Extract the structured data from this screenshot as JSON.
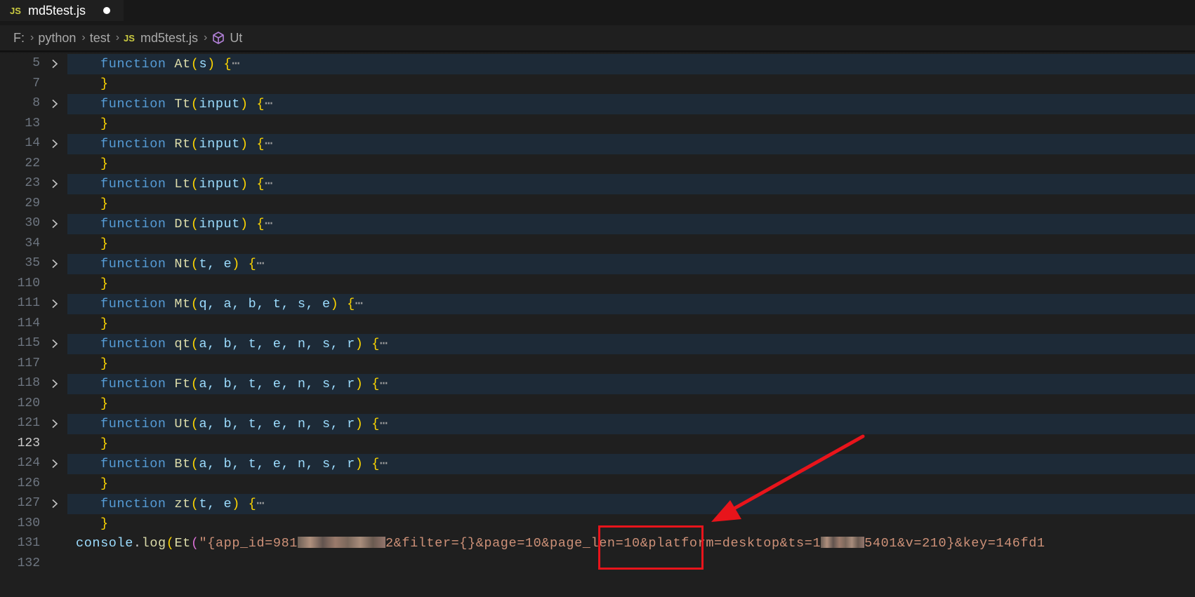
{
  "tab": {
    "icon": "JS",
    "title": "md5test.js"
  },
  "breadcrumb": {
    "items": [
      "F:",
      "python",
      "test",
      "md5test.js",
      "Ut"
    ],
    "js_icon": "JS"
  },
  "editor": {
    "lines": [
      {
        "n": "5",
        "sig": "function",
        "name": "At",
        "params": "s",
        "folded": true
      },
      {
        "n": "7",
        "close": "}"
      },
      {
        "n": "8",
        "sig": "function",
        "name": "Tt",
        "params": "input",
        "folded": true
      },
      {
        "n": "13",
        "close": "}"
      },
      {
        "n": "14",
        "sig": "function",
        "name": "Rt",
        "params": "input",
        "folded": true
      },
      {
        "n": "22",
        "close": "}"
      },
      {
        "n": "23",
        "sig": "function",
        "name": "Lt",
        "params": "input",
        "folded": true
      },
      {
        "n": "29",
        "close": "}"
      },
      {
        "n": "30",
        "sig": "function",
        "name": "Dt",
        "params": "input",
        "folded": true
      },
      {
        "n": "34",
        "close": "}"
      },
      {
        "n": "35",
        "sig": "function",
        "name": "Nt",
        "params": "t, e",
        "folded": true
      },
      {
        "n": "110",
        "close": "}"
      },
      {
        "n": "111",
        "sig": "function",
        "name": "Mt",
        "params": "q, a, b, t, s, e",
        "folded": true
      },
      {
        "n": "114",
        "close": "}"
      },
      {
        "n": "115",
        "sig": "function",
        "name": "qt",
        "params": "a, b, t, e, n, s, r",
        "folded": true
      },
      {
        "n": "117",
        "close": "}"
      },
      {
        "n": "118",
        "sig": "function",
        "name": "Ft",
        "params": "a, b, t, e, n, s, r",
        "folded": true
      },
      {
        "n": "120",
        "close": "}"
      },
      {
        "n": "121",
        "sig": "function",
        "name": "Ut",
        "params": "a, b, t, e, n, s, r",
        "folded": true
      },
      {
        "n": "123",
        "close": "}",
        "active": true
      },
      {
        "n": "124",
        "sig": "function",
        "name": "Bt",
        "params": "a, b, t, e, n, s, r",
        "folded": true
      },
      {
        "n": "126",
        "close": "}"
      },
      {
        "n": "127",
        "sig": "function",
        "name": "zt",
        "params": "t, e",
        "folded": true
      },
      {
        "n": "130",
        "close": "}"
      },
      {
        "n": "131",
        "console": true
      },
      {
        "n": "132",
        "empty": true
      }
    ],
    "console_line": {
      "obj": "console",
      "method": "log",
      "fn": "Et",
      "str_a": "\"{app_id=981",
      "str_b": "2&filter={}&page=10&page_len=10&platform=desktop&ts=1",
      "str_c": "5401&v=210}&key=146fd1"
    }
  },
  "colors": {
    "highlight_box": "#e8141b",
    "arrow": "#e8141b"
  }
}
